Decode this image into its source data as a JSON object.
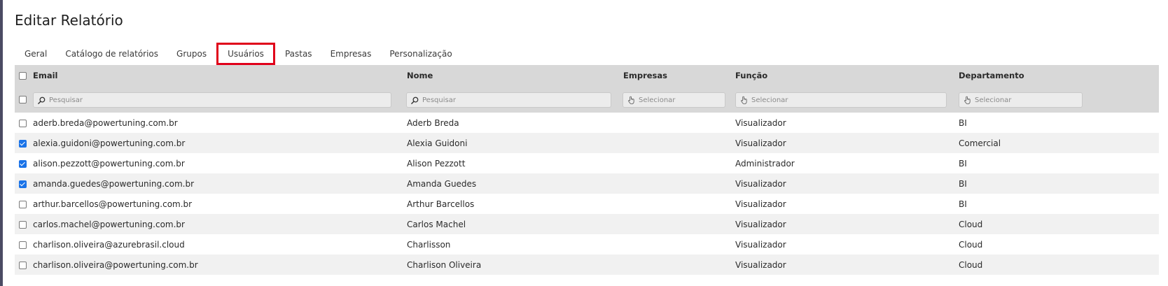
{
  "page": {
    "title": "Editar Relatório"
  },
  "tabs": [
    {
      "label": "Geral",
      "active": false
    },
    {
      "label": "Catálogo de relatórios",
      "active": false
    },
    {
      "label": "Grupos",
      "active": false
    },
    {
      "label": "Usuários",
      "active": true
    },
    {
      "label": "Pastas",
      "active": false
    },
    {
      "label": "Empresas",
      "active": false
    },
    {
      "label": "Personalização",
      "active": false
    }
  ],
  "table": {
    "columns": [
      "Email",
      "Nome",
      "Empresas",
      "Função",
      "Departamento"
    ],
    "filters": {
      "email": {
        "placeholder": "Pesquisar",
        "icon": "search-icon"
      },
      "nome": {
        "placeholder": "Pesquisar",
        "icon": "search-icon"
      },
      "empresas": {
        "placeholder": "Selecionar",
        "icon": "hand-pointer-icon"
      },
      "funcao": {
        "placeholder": "Selecionar",
        "icon": "hand-pointer-icon"
      },
      "departamento": {
        "placeholder": "Selecionar",
        "icon": "hand-pointer-icon"
      }
    },
    "rows": [
      {
        "checked": false,
        "email": "aderb.breda@powertuning.com.br",
        "nome": "Aderb Breda",
        "empresas": "",
        "funcao": "Visualizador",
        "departamento": "BI"
      },
      {
        "checked": true,
        "email": "alexia.guidoni@powertuning.com.br",
        "nome": "Alexia Guidoni",
        "empresas": "",
        "funcao": "Visualizador",
        "departamento": "Comercial"
      },
      {
        "checked": true,
        "email": "alison.pezzott@powertuning.com.br",
        "nome": "Alison Pezzott",
        "empresas": "",
        "funcao": "Administrador",
        "departamento": "BI"
      },
      {
        "checked": true,
        "email": "amanda.guedes@powertuning.com.br",
        "nome": "Amanda Guedes",
        "empresas": "",
        "funcao": "Visualizador",
        "departamento": "BI"
      },
      {
        "checked": false,
        "email": "arthur.barcellos@powertuning.com.br",
        "nome": "Arthur Barcellos",
        "empresas": "",
        "funcao": "Visualizador",
        "departamento": "BI"
      },
      {
        "checked": false,
        "email": "carlos.machel@powertuning.com.br",
        "nome": "Carlos Machel",
        "empresas": "",
        "funcao": "Visualizador",
        "departamento": "Cloud"
      },
      {
        "checked": false,
        "email": "charlison.oliveira@azurebrasil.cloud",
        "nome": "Charlisson",
        "empresas": "",
        "funcao": "Visualizador",
        "departamento": "Cloud"
      },
      {
        "checked": false,
        "email": "charlison.oliveira@powertuning.com.br",
        "nome": "Charlison Oliveira",
        "empresas": "",
        "funcao": "Visualizador",
        "departamento": "Cloud"
      }
    ]
  },
  "colors": {
    "active_tab_border": "#e0001a",
    "header_bg": "#d8d8d8",
    "checkbox_checked": "#1a73e8",
    "row_alt": "#f1f1f1"
  }
}
